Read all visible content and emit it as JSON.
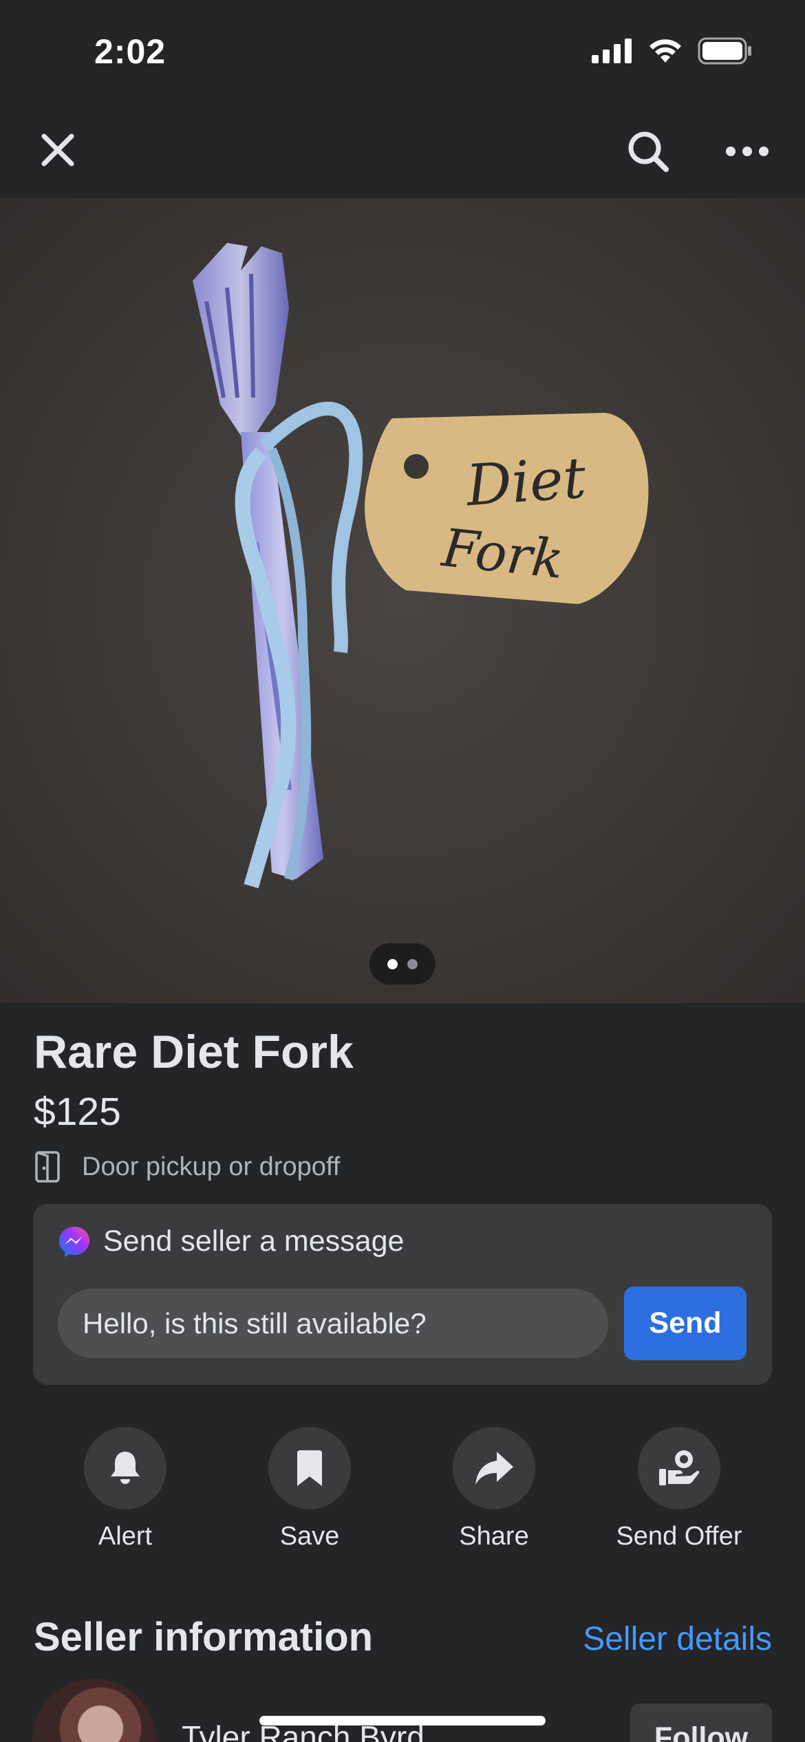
{
  "status_bar": {
    "time": "2:02",
    "signal_icon": "cellular-signal-icon",
    "wifi_icon": "wifi-icon",
    "battery_icon": "battery-icon"
  },
  "top_bar": {
    "close_icon": "close-icon",
    "search_icon": "search-icon",
    "more_icon": "more-horizontal-icon"
  },
  "photo": {
    "description_tag_text": "Diet Fork",
    "page_indicator": {
      "count": 2,
      "active_index": 0
    }
  },
  "listing": {
    "title": "Rare Diet Fork",
    "price": "$125",
    "pickup": "Door pickup or dropoff",
    "pickup_icon": "door-icon"
  },
  "message": {
    "header": "Send seller a message",
    "header_icon": "messenger-icon",
    "input_value": "Hello, is this still available?",
    "send_label": "Send"
  },
  "actions": [
    {
      "label": "Alert",
      "icon": "bell-icon"
    },
    {
      "label": "Save",
      "icon": "bookmark-icon"
    },
    {
      "label": "Share",
      "icon": "share-arrow-icon"
    },
    {
      "label": "Send Offer",
      "icon": "offer-hand-icon"
    }
  ],
  "seller": {
    "heading": "Seller information",
    "details_link": "Seller details",
    "name": "Tyler Ranch Byrd",
    "follow_label": "Follow"
  },
  "colors": {
    "background": "#242526",
    "card": "#3a3b3c",
    "accent_blue": "#2d6fe0",
    "link_blue": "#4599ff"
  }
}
